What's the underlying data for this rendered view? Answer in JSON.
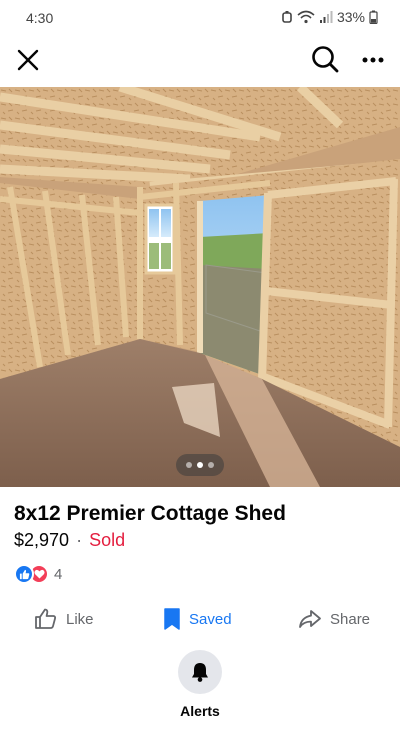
{
  "status_bar": {
    "time": "4:30",
    "battery": "33%",
    "icons": [
      "silent-icon",
      "wifi-icon",
      "signal-icon",
      "battery-icon"
    ]
  },
  "nav": {
    "icons": [
      "close-icon",
      "search-icon",
      "more-icon"
    ]
  },
  "photo": {
    "dots": 3,
    "active_dot": 2
  },
  "listing": {
    "title": "8x12 Premier Cottage Shed",
    "price": "$2,970",
    "separator": "·",
    "status": "Sold"
  },
  "reactions": {
    "icons": [
      "like-reaction-icon",
      "love-reaction-icon"
    ],
    "count": "4"
  },
  "actions": {
    "like_label": "Like",
    "saved_label": "Saved",
    "share_label": "Share"
  },
  "alerts": {
    "label": "Alerts"
  },
  "colors": {
    "accent": "#1877f2",
    "sold": "#e41e3f",
    "muted": "#65676b"
  }
}
